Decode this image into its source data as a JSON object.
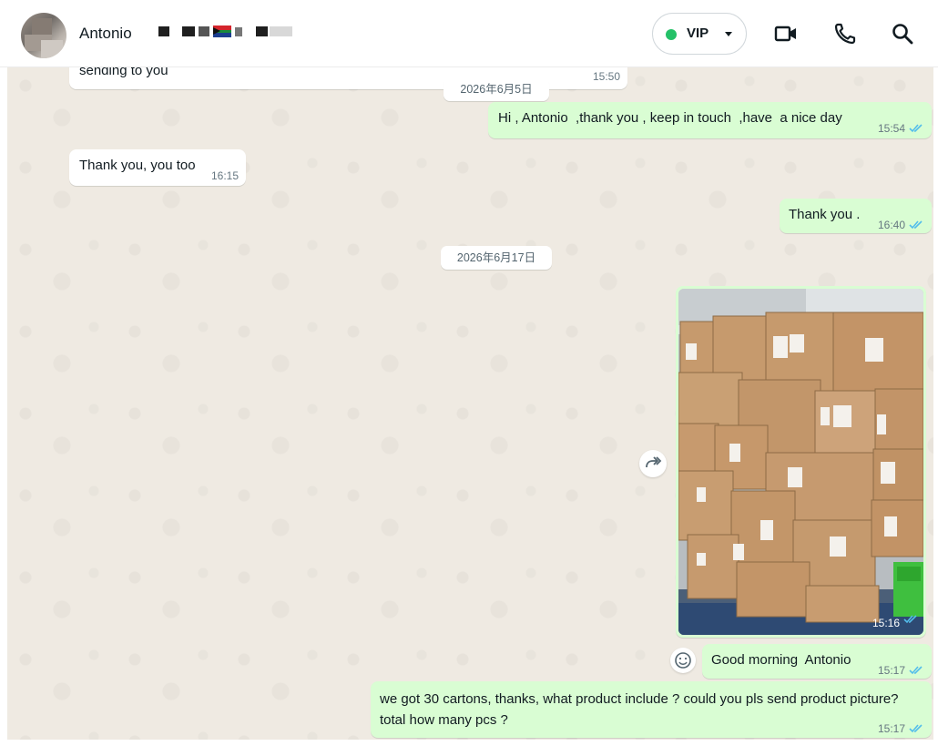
{
  "header": {
    "contact_name": "Antonio",
    "status_pill": {
      "label": "VIP",
      "status_color": "#25c168"
    },
    "icons": [
      "video-call-icon",
      "voice-call-icon",
      "search-icon"
    ]
  },
  "messages": [
    {
      "direction": "in",
      "text": "sending to you",
      "time": "15:50"
    },
    {
      "type": "date",
      "text": "2026年6月5日"
    },
    {
      "direction": "out",
      "text": "Hi , Antonio  ,thank you , keep in touch  ,have  a nice day",
      "time": "15:54",
      "status": "read"
    },
    {
      "direction": "in",
      "text": "Thank you, you too",
      "time": "16:15"
    },
    {
      "direction": "out",
      "text": "Thank you .",
      "time": "16:40",
      "status": "read"
    },
    {
      "type": "date",
      "text": "2026年6月17日"
    },
    {
      "direction": "out",
      "type": "image",
      "caption": "",
      "time": "15:16",
      "status": "read"
    },
    {
      "direction": "out",
      "text": "Good morning  Antonio",
      "time": "15:17",
      "status": "read"
    },
    {
      "direction": "out",
      "text": "we got 30 cartons, thanks, what product include ? could you pls send product picture? total how many pcs ?",
      "time": "15:17",
      "status": "read"
    }
  ],
  "colors": {
    "incoming_bubble": "#ffffff",
    "outgoing_bubble": "#d9fdd3",
    "chat_background": "#efeae2",
    "read_ticks": "#53bdeb"
  }
}
